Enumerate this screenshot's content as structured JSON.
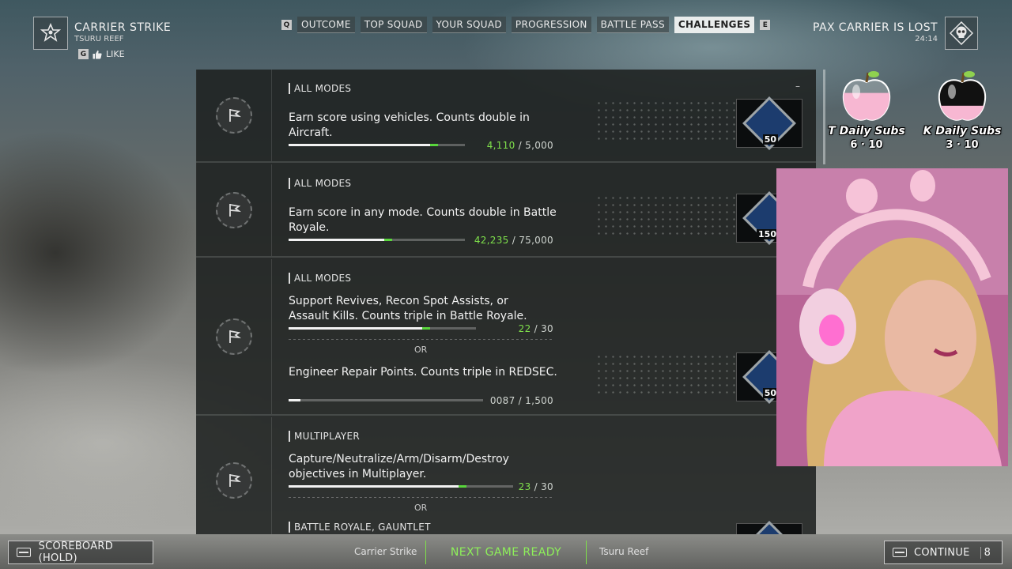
{
  "header": {
    "mode_title": "CARRIER STRIKE",
    "map_name": "TSURU REEF",
    "like_key": "G",
    "like_label": "LIKE",
    "icon": "carrier-strike-emblem-icon"
  },
  "tabs": {
    "prev_key": "Q",
    "next_key": "E",
    "items": [
      {
        "label": "OUTCOME",
        "active": false
      },
      {
        "label": "TOP SQUAD",
        "active": false
      },
      {
        "label": "YOUR SQUAD",
        "active": false
      },
      {
        "label": "PROGRESSION",
        "active": false
      },
      {
        "label": "BATTLE PASS",
        "active": false
      },
      {
        "label": "CHALLENGES",
        "active": true
      }
    ]
  },
  "status": {
    "title": "PAX CARRIER IS LOST",
    "time": "24:14",
    "icon": "skull-icon"
  },
  "challenges": [
    {
      "tag": "ALL MODES",
      "objectives": [
        {
          "desc": "Earn score using vehicles. Counts double in Aircraft.",
          "current": "4,110",
          "total": "5,000",
          "progress": 0.82
        }
      ],
      "reward": "50"
    },
    {
      "tag": "ALL MODES",
      "objectives": [
        {
          "desc": "Earn score in any mode. Counts double in Battle Royale.",
          "current": "42,235",
          "total": "75,000",
          "progress": 0.56
        }
      ],
      "reward": "150"
    },
    {
      "tag": "ALL MODES",
      "objectives": [
        {
          "desc": "Support Revives, Recon Spot Assists, or Assault Kills. Counts triple in Battle Royale.",
          "current": "22",
          "total": "30",
          "progress": 0.73
        },
        {
          "desc": "Engineer Repair Points. Counts triple in REDSEC.",
          "current": "0087",
          "total": "1,500",
          "progress": 0.06
        }
      ],
      "or_label": "OR",
      "reward": "50"
    },
    {
      "tag": "MULTIPLAYER",
      "objectives": [
        {
          "desc": "Capture/Neutralize/Arm/Disarm/Destroy objectives in Multiplayer.",
          "current": "23",
          "total": "30",
          "progress": 0.77
        }
      ],
      "or_label": "OR",
      "next_tag": "BATTLE ROYALE, GAUNTLET"
    }
  ],
  "panel_dash": "–",
  "sub_goals": [
    {
      "label": "T Daily Subs",
      "count": "6 · 10",
      "fill": 0.6,
      "color": "#f7b7d2"
    },
    {
      "label": "K Daily Subs",
      "count": "3 · 10",
      "fill": 0.3,
      "color": "#f7b7d2"
    }
  ],
  "footer": {
    "scoreboard_label": "SCOREBOARD (HOLD)",
    "left_crumb": "Carrier Strike",
    "next_ready": "NEXT GAME READY",
    "right_crumb": "Tsuru Reef",
    "continue_label": "CONTINUE",
    "continue_count": "8",
    "accent": "#8ef05a"
  }
}
